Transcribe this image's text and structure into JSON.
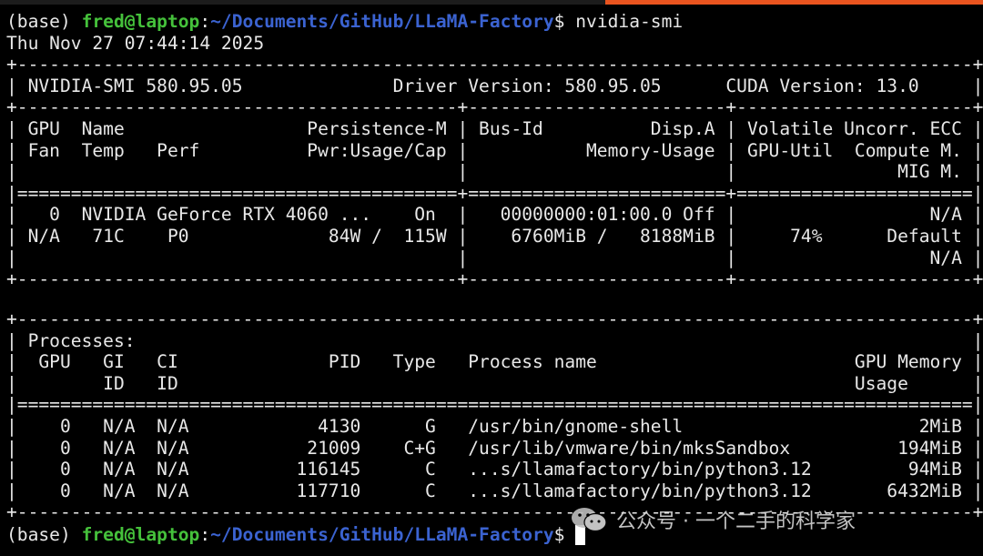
{
  "prompt_top": {
    "env": "(base) ",
    "userhost": "fred@laptop",
    "sep": ":",
    "path": "~/Documents/GitHub/LLaMA-Factory",
    "symbol": "$ ",
    "command": "nvidia-smi"
  },
  "timestamp": "Thu Nov 27 07:44:14 2025",
  "gpu_table": [
    "+-----------------------------------------------------------------------------------------+",
    "| NVIDIA-SMI 580.95.05              Driver Version: 580.95.05      CUDA Version: 13.0     |",
    "+-----------------------------------------+------------------------+----------------------+",
    "| GPU  Name                 Persistence-M | Bus-Id          Disp.A | Volatile Uncorr. ECC |",
    "| Fan  Temp   Perf          Pwr:Usage/Cap |           Memory-Usage | GPU-Util  Compute M. |",
    "|                                         |                        |               MIG M. |",
    "|=========================================+========================+======================|",
    "|   0  NVIDIA GeForce RTX 4060 ...    On  |   00000000:01:00.0 Off |                  N/A |",
    "| N/A   71C    P0             84W /  115W |    6760MiB /   8188MiB |     74%      Default |",
    "|                                         |                        |                  N/A |",
    "+-----------------------------------------+------------------------+----------------------+"
  ],
  "blank_line": "",
  "process_table": [
    "+-----------------------------------------------------------------------------------------+",
    "| Processes:                                                                              |",
    "|  GPU   GI   CI              PID   Type   Process name                        GPU Memory |",
    "|        ID   ID                                                               Usage      |",
    "|=========================================================================================|",
    "|    0   N/A  N/A            4130      G   /usr/bin/gnome-shell                      2MiB |",
    "|    0   N/A  N/A           21009    C+G   /usr/lib/vmware/bin/mksSandbox          194MiB |",
    "|    0   N/A  N/A          116145      C   ...s/llamafactory/bin/python3.12         94MiB |",
    "|    0   N/A  N/A          117710      C   ...s/llamafactory/bin/python3.12       6432MiB |",
    "+-----------------------------------------------------------------------------------------+"
  ],
  "prompt_bottom": {
    "env": "(base) ",
    "userhost": "fred@laptop",
    "sep": ":",
    "path": "~/Documents/GitHub/LLaMA-Factory",
    "symbol": "$ "
  },
  "watermark": {
    "text": "公众号 · 一个二手的科学家",
    "icon": "wechat-icon"
  },
  "colors": {
    "user": "#45c13b",
    "path": "#3b63d1",
    "text": "#e8e8e8",
    "background": "#000000",
    "accent": "#e9541f"
  }
}
